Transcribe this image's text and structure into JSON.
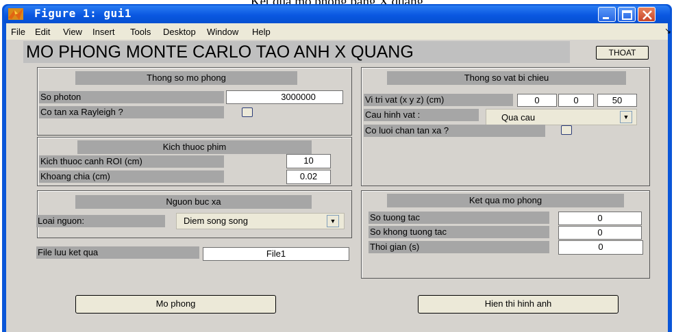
{
  "caption_top": "Kết quả mô phỏng bằng X quang",
  "window": {
    "title": "Figure 1: gui1"
  },
  "menu": [
    {
      "label": "File"
    },
    {
      "label": "Edit"
    },
    {
      "label": "View"
    },
    {
      "label": "Insert"
    },
    {
      "label": "Tools"
    },
    {
      "label": "Desktop"
    },
    {
      "label": "Window"
    },
    {
      "label": "Help"
    }
  ],
  "menu_grip": "↘",
  "heading": "MO PHONG MONTE CARLO TAO ANH X QUANG",
  "exit_button": "THOAT",
  "sim_params": {
    "title": "Thong so mo phong",
    "photon_label": "So photon",
    "photon_value": "3000000",
    "rayleigh_label": "Co tan xa Rayleigh ?",
    "rayleigh_checked": false
  },
  "film_size": {
    "title": "Kich thuoc phim",
    "roi_label": "Kich thuoc canh ROI (cm)",
    "roi_value": "10",
    "division_label": "Khoang chia (cm)",
    "division_value": "0.02"
  },
  "source": {
    "title": "Nguon buc xa",
    "type_label": "Loai nguon:",
    "type_value": "Diem song song"
  },
  "output_file": {
    "label": "File luu ket qua",
    "value": "File1"
  },
  "object_params": {
    "title": "Thong so vat bi chieu",
    "position_label": "Vi tri vat (x y z) (cm)",
    "x": "0",
    "y": "0",
    "z": "50",
    "shape_label": "Cau hinh vat :",
    "shape_value": "Qua cau",
    "grid_label": "Co luoi chan tan xa ?",
    "grid_checked": false
  },
  "results": {
    "title": "Ket qua mo phong",
    "interacted_label": "So tuong tac",
    "interacted_value": "0",
    "not_interacted_label": "So khong tuong tac",
    "not_interacted_value": "0",
    "time_label": "Thoi gian (s)",
    "time_value": "0"
  },
  "buttons": {
    "simulate": "Mo phong",
    "show_image": "Hien thi hinh anh"
  },
  "dropdown_arrow": "▼",
  "colors": {
    "titlebar": "#0a57e1",
    "client": "#d6d3ce",
    "label_bg": "#a6a6a6"
  }
}
